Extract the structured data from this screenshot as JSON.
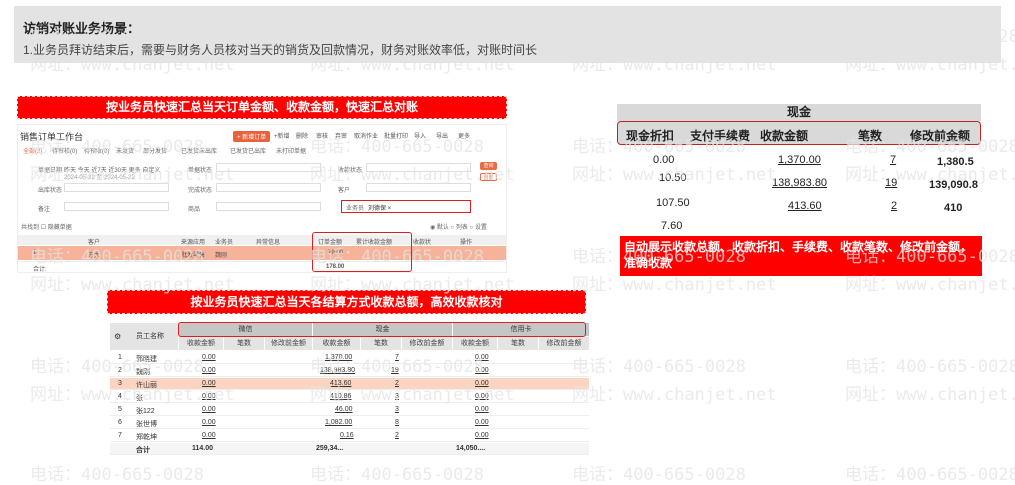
{
  "banner": {
    "title": "访销对账业务场景：",
    "desc": "1.业务员拜访结束后，需要与财务人员核对当天的销货及回款情况，财务对账效率低，对账时间长"
  },
  "watermark": {
    "phone": "电话：400-665-0028",
    "site": "网址：www.chanjet.net"
  },
  "callouts": {
    "top": "按业务员快速汇总当天订单金额、收款金额，快速汇总对账",
    "middle": "按业务员快速汇总当天各结算方式收款总额，高效收款核对",
    "note": "自动展示收款总额、收款折扣、手续费、收款笔数、修改前金额，准确收款"
  },
  "s1": {
    "title": "销售订单工作台",
    "toolbar": [
      "+新增",
      "删除",
      "审核",
      "弃审",
      "取消作业",
      "批量打印",
      "导入",
      "导出",
      "更多"
    ],
    "toolbar_red": "+ 新增订单",
    "tabs": [
      "全部(2)",
      "待审核(0)",
      "待预收(0)",
      "未发货",
      "部分发货",
      "已发货未出库",
      "已发货已出库",
      "未打印单据"
    ],
    "form": {
      "date_label": "单据日期",
      "date_opts": "昨天 今天 近7天 近30天 更多 自定义",
      "date_range": "2024-05-22 至 2024-05-22",
      "status": "单据状态",
      "receipt": "收款状态",
      "outbound": "出库状态",
      "complete": "完成状态",
      "customer": "客户",
      "remark": "备注",
      "product": "商品",
      "salesman": "业务员",
      "chip": "刘德保 ×",
      "search": "查询",
      "reset": "重置"
    },
    "opt_left": "共找到 ☐ 隐藏单据",
    "opt_right": "◉ 默认  ○ 列表  ○ 设置",
    "headers": [
      "客户",
      "来源应用",
      "业务员",
      "异常信息",
      "订单金额",
      "累计收款金额",
      "收款状",
      "操作"
    ],
    "row": {
      "no": "1",
      "customer": "方大",
      "source": "批发零售",
      "salesman": "魏刚",
      "amount": "79.00",
      "received": "79.00"
    },
    "sum": {
      "label": "合计:",
      "amount": "178.00"
    }
  },
  "cash": {
    "title": "现金",
    "cols": [
      "现金折扣",
      "支付手续费",
      "收款金额",
      "笔数",
      "修改前金额"
    ],
    "rows": [
      {
        "discount": "0.00",
        "fee": "",
        "amount": "1,370.00",
        "count": "7",
        "before": "1,380.5"
      },
      {
        "discount": "10.50",
        "fee": "",
        "amount": "138,983.80",
        "count": "19",
        "before": "139,090.8"
      },
      {
        "discount": "107.50",
        "fee": "",
        "amount": "413.60",
        "count": "2",
        "before": "410"
      },
      {
        "discount": "7.60",
        "fee": "",
        "amount": "",
        "count": "",
        "before": ""
      }
    ]
  },
  "s2": {
    "groups": [
      "微信",
      "现金",
      "信用卡"
    ],
    "col_name": "员工名称",
    "sub": [
      "收款金额",
      "笔数",
      "修改前金额"
    ],
    "rows": [
      {
        "no": "1",
        "name": "郭晓建",
        "wx": "0.00",
        "cash": "1,370.00",
        "cnt": "7",
        "cc": "0.00"
      },
      {
        "no": "2",
        "name": "魏刚",
        "wx": "0.00",
        "cash": "138,983.80",
        "cnt": "19",
        "cc": "0.00"
      },
      {
        "no": "3",
        "name": "许山丽",
        "wx": "0.00",
        "cash": "413.60",
        "cnt": "2",
        "cc": "0.00"
      },
      {
        "no": "4",
        "name": "张",
        "wx": "0.00",
        "cash": "410.86",
        "cnt": "3",
        "cc": "0.00"
      },
      {
        "no": "5",
        "name": "张122",
        "wx": "0.00",
        "cash": "46.00",
        "cnt": "3",
        "cc": "0.00"
      },
      {
        "no": "6",
        "name": "张世博",
        "wx": "0.00",
        "cash": "1,082.00",
        "cnt": "8",
        "cc": "0.00"
      },
      {
        "no": "7",
        "name": "郑乾坤",
        "wx": "0.00",
        "cash": "0.16",
        "cnt": "2",
        "cc": "0.00"
      }
    ],
    "total": {
      "label": "合计",
      "wx": "114.00",
      "cash": "259,34...",
      "cc": "14,050...."
    }
  }
}
